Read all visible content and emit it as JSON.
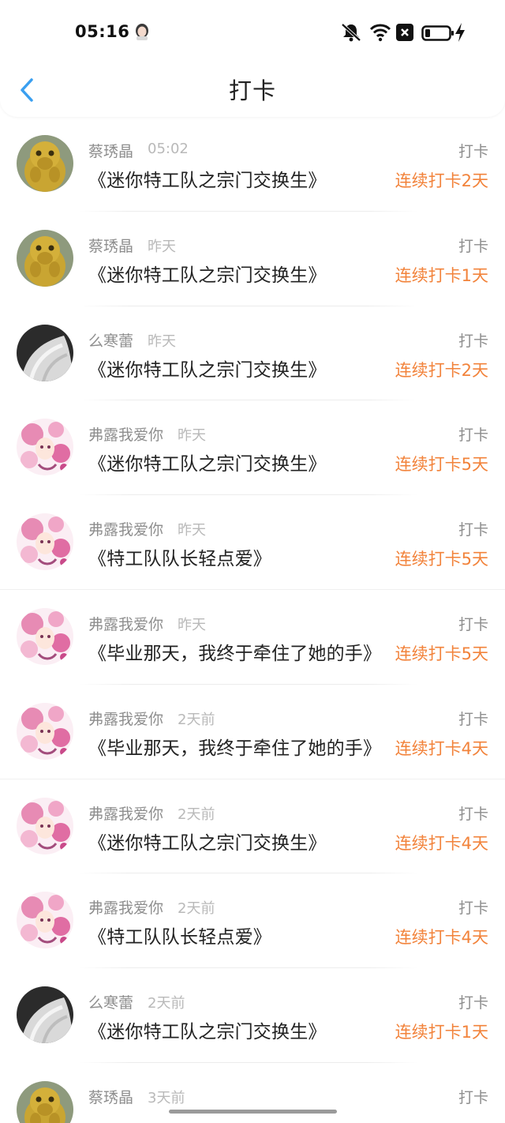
{
  "status_bar": {
    "time": "05:16",
    "icons": [
      "avatar-icon",
      "bell-muted-icon",
      "wifi-icon",
      "close-box-icon",
      "battery-icon",
      "charging-icon"
    ]
  },
  "nav": {
    "title": "打卡",
    "back_icon": "chevron-left-icon"
  },
  "colors": {
    "accent": "#3a9ff0",
    "streak": "#f2833b",
    "muted": "#8e8e8e"
  },
  "entries": [
    {
      "user": "蔡琇晶",
      "time": "05:02",
      "book": "《迷你特工队之宗门交换生》",
      "action": "打卡",
      "streak": "连续打卡2天",
      "avatar": "monkey"
    },
    {
      "user": "蔡琇晶",
      "time": "昨天",
      "book": "《迷你特工队之宗门交换生》",
      "action": "打卡",
      "streak": "连续打卡1天",
      "avatar": "monkey"
    },
    {
      "user": "么寒蕾",
      "time": "昨天",
      "book": "《迷你特工队之宗门交换生》",
      "action": "打卡",
      "streak": "连续打卡2天",
      "avatar": "fabric"
    },
    {
      "user": "弗露我爱你",
      "time": "昨天",
      "book": "《迷你特工队之宗门交换生》",
      "action": "打卡",
      "streak": "连续打卡5天",
      "avatar": "anime"
    },
    {
      "user": "弗露我爱你",
      "time": "昨天",
      "book": "《特工队队长轻点爱》",
      "action": "打卡",
      "streak": "连续打卡5天",
      "avatar": "anime"
    },
    {
      "user": "弗露我爱你",
      "time": "昨天",
      "book": "《毕业那天，我终于牵住了她的手》",
      "action": "打卡",
      "streak": "连续打卡5天",
      "avatar": "anime"
    },
    {
      "user": "弗露我爱你",
      "time": "2天前",
      "book": "《毕业那天，我终于牵住了她的手》",
      "action": "打卡",
      "streak": "连续打卡4天",
      "avatar": "anime"
    },
    {
      "user": "弗露我爱你",
      "time": "2天前",
      "book": "《迷你特工队之宗门交换生》",
      "action": "打卡",
      "streak": "连续打卡4天",
      "avatar": "anime"
    },
    {
      "user": "弗露我爱你",
      "time": "2天前",
      "book": "《特工队队长轻点爱》",
      "action": "打卡",
      "streak": "连续打卡4天",
      "avatar": "anime"
    },
    {
      "user": "么寒蕾",
      "time": "2天前",
      "book": "《迷你特工队之宗门交换生》",
      "action": "打卡",
      "streak": "连续打卡1天",
      "avatar": "fabric"
    },
    {
      "user": "蔡琇晶",
      "time": "3天前",
      "book": "",
      "action": "打卡",
      "streak": "",
      "avatar": "monkey"
    }
  ]
}
